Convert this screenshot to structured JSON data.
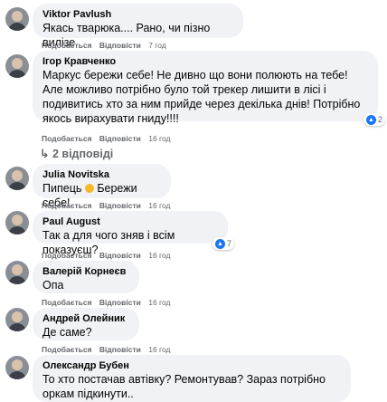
{
  "actions": {
    "like": "Подобається",
    "reply": "Відповісти"
  },
  "replies_link": "2 відповіді",
  "comments": [
    {
      "author": "Viktor Pavlush",
      "text": "Якась тварюка.... Рано, чи пізно вилізе",
      "time": "7 год"
    },
    {
      "author": "Ігор Кравченко",
      "text": "Маркус бережи себе! Не дивно що вони полюють на тебе! Але можливо потрібно було той трекер лишити в лісі і подивитись хто за ним прийде через декілька днів! Потрібно якось вирахувати гниду!!!!",
      "time": "16 год",
      "reactions": "2"
    },
    {
      "author": "Julia Novitska",
      "text_before": "Пипець",
      "text_after": "Бережи себе!",
      "time": "16 год"
    },
    {
      "author": "Paul August",
      "text": "Так а для чого зняв і всім показуєш?",
      "time": "16 год",
      "reactions": "7"
    },
    {
      "author": "Валерій Корнеєв",
      "text": "Опа",
      "time": "16 год"
    },
    {
      "author": "Андрей Олейник",
      "text": "Де саме?",
      "time": "16 год"
    },
    {
      "author": "Олександр Бубен",
      "text": "То хто постачав автівку? Ремонтував? Зараз потрібно оркам підкинути.."
    }
  ],
  "colors": {
    "bubble": "#f0f2f5",
    "meta": "#65676b",
    "like_badge": "#1877f2"
  },
  "icons": [
    "like-icon",
    "laugh-emoji-icon",
    "reply-arrow-icon"
  ]
}
